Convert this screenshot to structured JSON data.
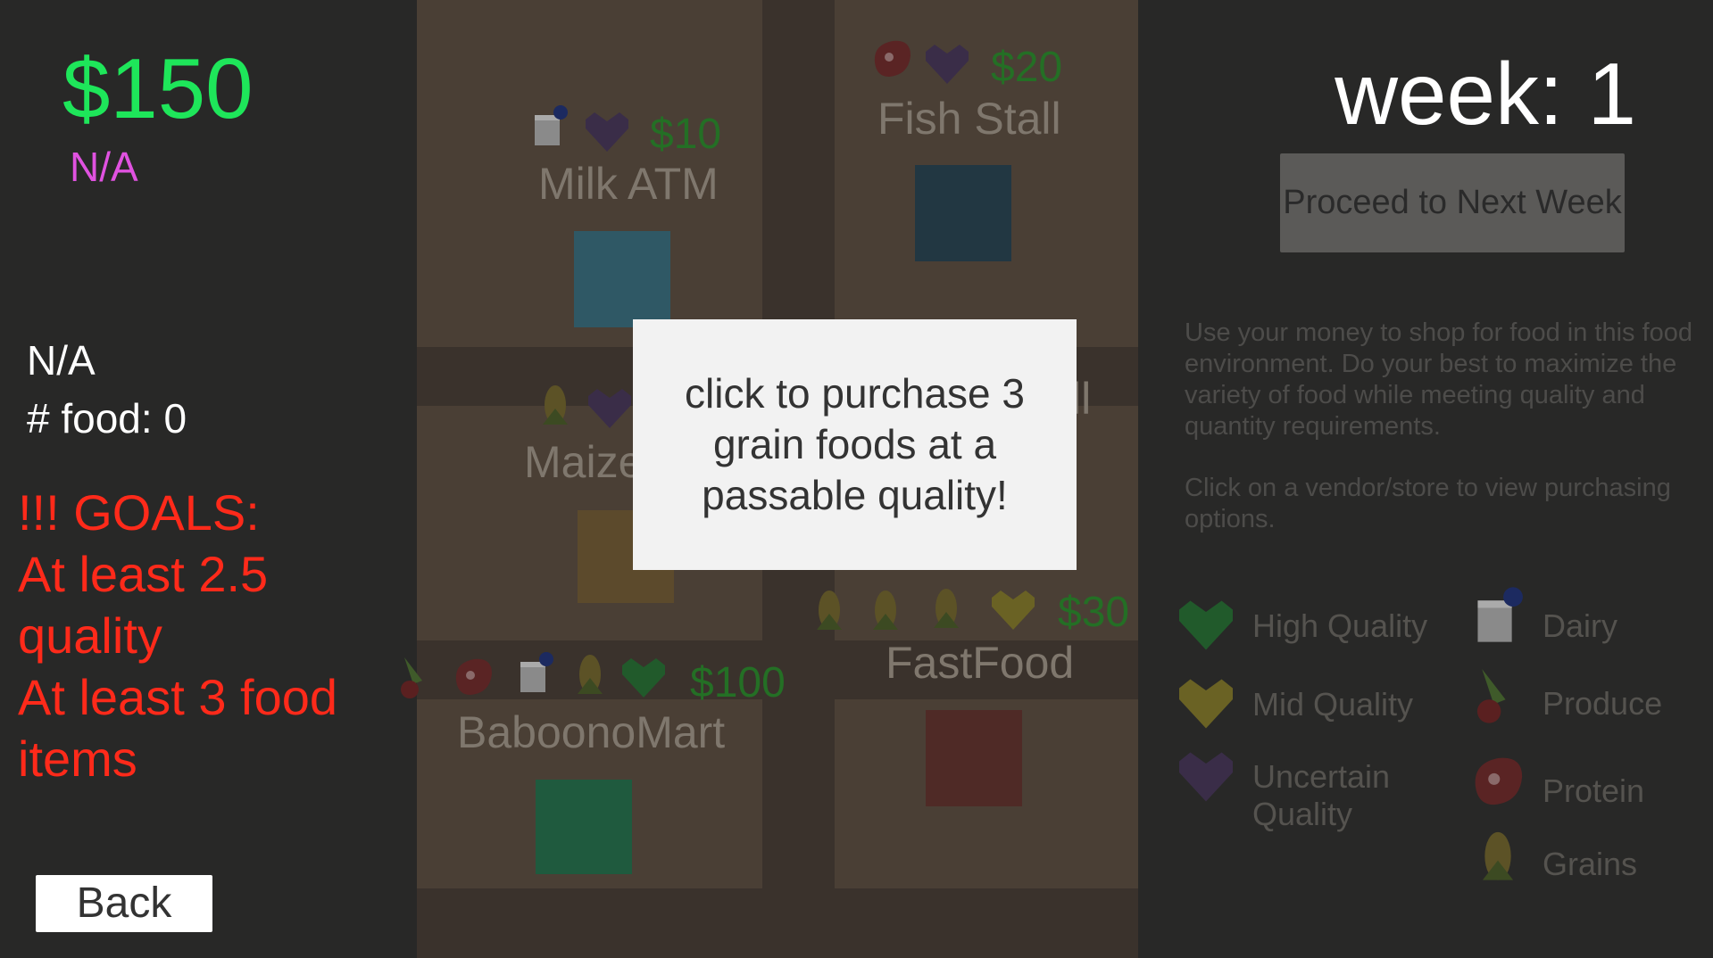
{
  "hud": {
    "money": "$150",
    "status_top": "N/A",
    "status_mid": "N/A",
    "food_count": "# food: 0",
    "goals_lines": [
      "!!! GOALS:",
      "At least 2.5",
      "quality",
      "At least 3 food",
      "items"
    ],
    "back_label": "Back"
  },
  "week": {
    "label": "week: 1",
    "next_button": "Proceed to Next Week"
  },
  "instructions": [
    "Use your money to shop for food in this food environment. Do your best to maximize the variety of food while meeting quality and quantity requirements.",
    "Click on a vendor/store to view purchasing options."
  ],
  "vendors": {
    "milk_atm": {
      "name": "Milk ATM",
      "price": "$10",
      "color": "#2f5865"
    },
    "fish_stall": {
      "name": "Fish Stall",
      "price": "$20",
      "color": "#223742"
    },
    "maize": {
      "name": "Maize",
      "color": "#5c4a2c"
    },
    "babooomart": {
      "name": "BaboonoMart",
      "price": "$100",
      "color": "#1f5a3e"
    },
    "fastfood": {
      "name": "FastFood",
      "price": "$30",
      "color": "#4f2a26"
    },
    "hidden_suffix": "ll"
  },
  "legend": {
    "high_quality": "High Quality",
    "mid_quality": "Mid Quality",
    "uncertain_line1": "Uncertain",
    "uncertain_line2": "Quality",
    "dairy": "Dairy",
    "produce": "Produce",
    "protein": "Protein",
    "grains": "Grains"
  },
  "colors": {
    "money": "#1ee65a",
    "status": "#e052e0",
    "goals": "#ff2a1a",
    "high_quality": "#215a2b",
    "mid_quality": "#6a6224",
    "uncertain_quality": "#3a2d48"
  },
  "tooltip": {
    "text": "click to purchase 3 grain foods at a passable quality!"
  }
}
